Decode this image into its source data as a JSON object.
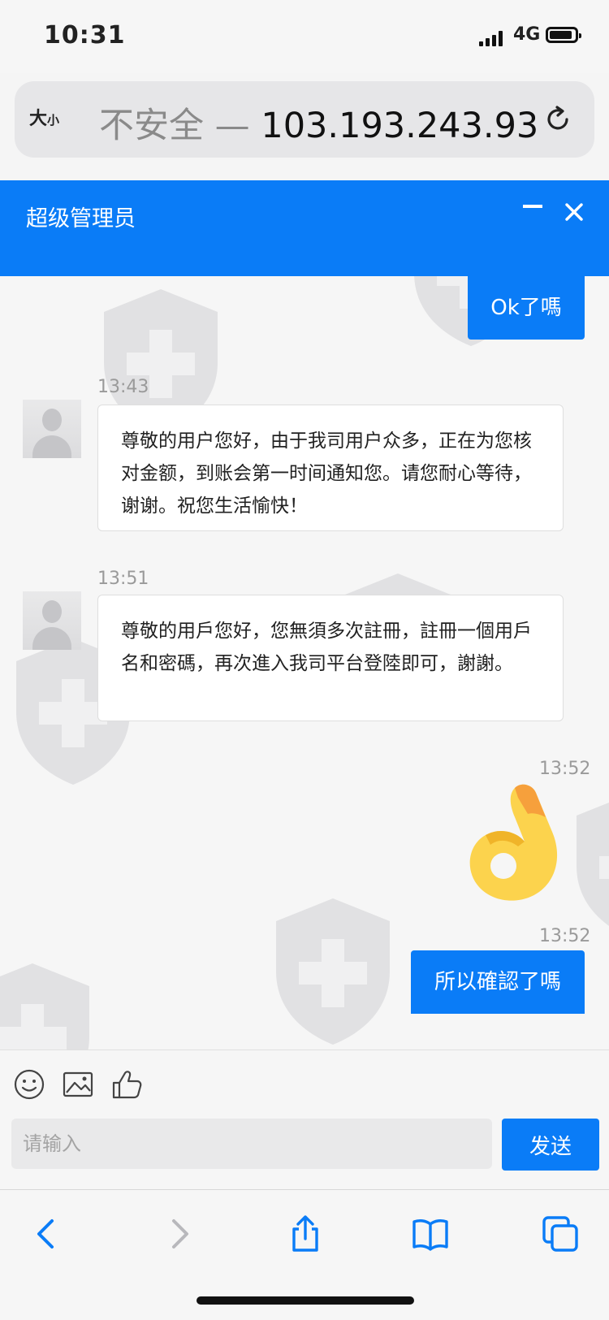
{
  "status_bar": {
    "time": "10:31",
    "network": "4G"
  },
  "address_bar": {
    "text_size_big": "大",
    "text_size_small": "小",
    "url_prefix": "不安全 — ",
    "url_host": "103.193.243.93"
  },
  "chat_header": {
    "title": "超级管理员"
  },
  "messages": [
    {
      "side": "right",
      "text": "Ok了嗎"
    },
    {
      "side": "left",
      "time": "13:43",
      "text": "尊敬的用户您好，由于我司用户众多，正在为您核对金额，到账会第一时间通知您。请您耐心等待，谢谢。祝您生活愉快！"
    },
    {
      "side": "left",
      "time": "13:51",
      "text": "尊敬的用戶您好，您無須多次註冊，註冊一個用戶名和密碼，再次進入我司平台登陸即可，謝謝。"
    },
    {
      "side": "right",
      "time": "13:52",
      "emoji": "ok-hand"
    },
    {
      "side": "right",
      "time": "13:52",
      "text": "所以確認了嗎"
    }
  ],
  "composer": {
    "placeholder": "请输入",
    "send_label": "发送"
  },
  "icons": [
    "reload-icon",
    "minimize-icon",
    "close-icon",
    "emoji-icon",
    "image-icon",
    "thumbs-up-icon",
    "back-icon",
    "forward-icon",
    "share-icon",
    "bookmarks-icon",
    "tabs-icon"
  ],
  "colors": {
    "accent": "#0a7cf7",
    "watermark": "#c8c8c8"
  }
}
